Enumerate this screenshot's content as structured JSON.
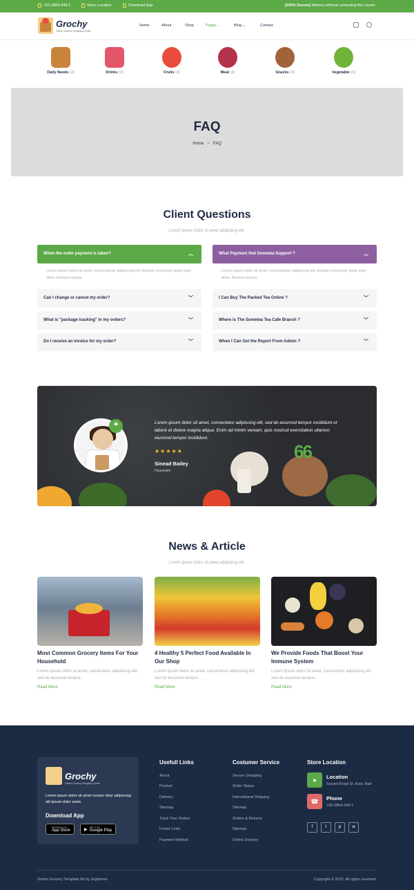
{
  "topbar": {
    "phone": "+62-2864-349-1",
    "store_location": "Store Location",
    "download_app": "Download App",
    "secure_bold": "(100% Secure)",
    "secure_rest": " delivery without contacting the courier."
  },
  "header": {
    "logo_name": "Grochy",
    "logo_tag": "Online Grocery Shopping Center",
    "nav": [
      "Home",
      "About",
      "Shop",
      "Pages",
      "Blog",
      "Contact"
    ],
    "active_nav": "Pages",
    "icons": [
      "cart-icon",
      "search-icon"
    ]
  },
  "categories": [
    {
      "name": "Daily Needs",
      "count": "(3)",
      "color": "#c8853a"
    },
    {
      "name": "Drinks",
      "count": "(3)",
      "color": "#e4576a"
    },
    {
      "name": "Fruits",
      "count": "(4)",
      "color": "#e94b3c"
    },
    {
      "name": "Meat",
      "count": "(3)",
      "color": "#b3334a"
    },
    {
      "name": "Snacks",
      "count": "(3)",
      "color": "#a0633a"
    },
    {
      "name": "Vegetable",
      "count": "(4)",
      "color": "#72b33c"
    }
  ],
  "banner": {
    "title": "FAQ",
    "breadcrumb_home": "Home",
    "breadcrumb_sep": ">",
    "breadcrumb_current": "FAQ"
  },
  "faq": {
    "title": "Client Questions",
    "subtitle": "Lorem ipsum dolor sit amet adipisting elit.",
    "left": [
      "When the order payment is taken?",
      "Can I change or cancel my order?",
      "What is \"package tracking\" in my orders?",
      "Do I receive an invoice for my order?"
    ],
    "right": [
      "What Payment that Sometea Support ?",
      "I Can Buy The Packed Tea Online ?",
      "Where is The Sometea Tea Cafe Branch ?",
      "When I Can Get the Report From Admin ?"
    ],
    "answer": "Lorem ipsum dolor sit amet, consectetuer adipiscing elit. Aenean commodo ligula eget dolor. Aenean massa."
  },
  "testimonial": {
    "text": "Lorem ipsum dolor sit amet, consectetur adipiscing elit, sed do eiusmod tempor incididunt ut labore et dolore magna aliqua. Enim ad minim veniam, quis nostrud exercitation ullamco eiusmod tempor incididunt.",
    "stars": "★★★★★",
    "name": "Sinead Bailey",
    "role": "Housewife",
    "quote_mark": "66"
  },
  "news": {
    "title": "News & Article",
    "subtitle": "Lorem ipsum dolor sit amet adipisting elit.",
    "articles": [
      {
        "title": "Most Common Grocery Items For Your Household",
        "desc": "Lorem ipsum dolor sit amet, consectetur adipiscing elit, sed do eiusmod tempor...",
        "more": "Read More"
      },
      {
        "title": "4 Healthy 5 Perfect Food Available In Our Shop",
        "desc": "Lorem ipsum dolor sit amet, consectetur adipiscing elit, sed do eiusmod tempor...",
        "more": "Read More"
      },
      {
        "title": "We Provide Foods That Boost Your Immune System",
        "desc": "Lorem ipsum dolor sit amet, consectetur adipiscing elit, sed do eiusmod tempor...",
        "more": "Read More"
      }
    ]
  },
  "footer": {
    "logo_name": "Grochy",
    "logo_tag": "Online Grocery Shopping Center",
    "desc": "Lorem ipsum dolor sit amet consec tetur adipiscing elit ipsum dolor amet.",
    "download_title": "Download App",
    "app_store_small": "Download on the",
    "app_store": "App Store",
    "google_play_small": "GET IT ON",
    "google_play": "Google Play",
    "useful_title": "Usefull Links",
    "useful": [
      "About",
      "Product",
      "Delivery",
      "Sitemap",
      "Track Your Orders",
      "Footer Links",
      "Payment Method"
    ],
    "service_title": "Costumer Service",
    "service": [
      "Secure Shopping",
      "Order Status",
      "International Shipping",
      "Sitemap",
      "Orders & Returns",
      "Sitemap",
      "Online Delivery"
    ],
    "store_title": "Store Location",
    "location_label": "Location",
    "location_value": "Sunset Road St. Kuta, Bali",
    "phone_label": "Phone",
    "phone_value": "+62-2864-349-1",
    "socials": [
      "f",
      "t",
      "p",
      "w"
    ],
    "copy_left": "Online Grocery Template Kit by Jegtheme",
    "copy_right": "Copyright © 2022. All rights reserved."
  }
}
